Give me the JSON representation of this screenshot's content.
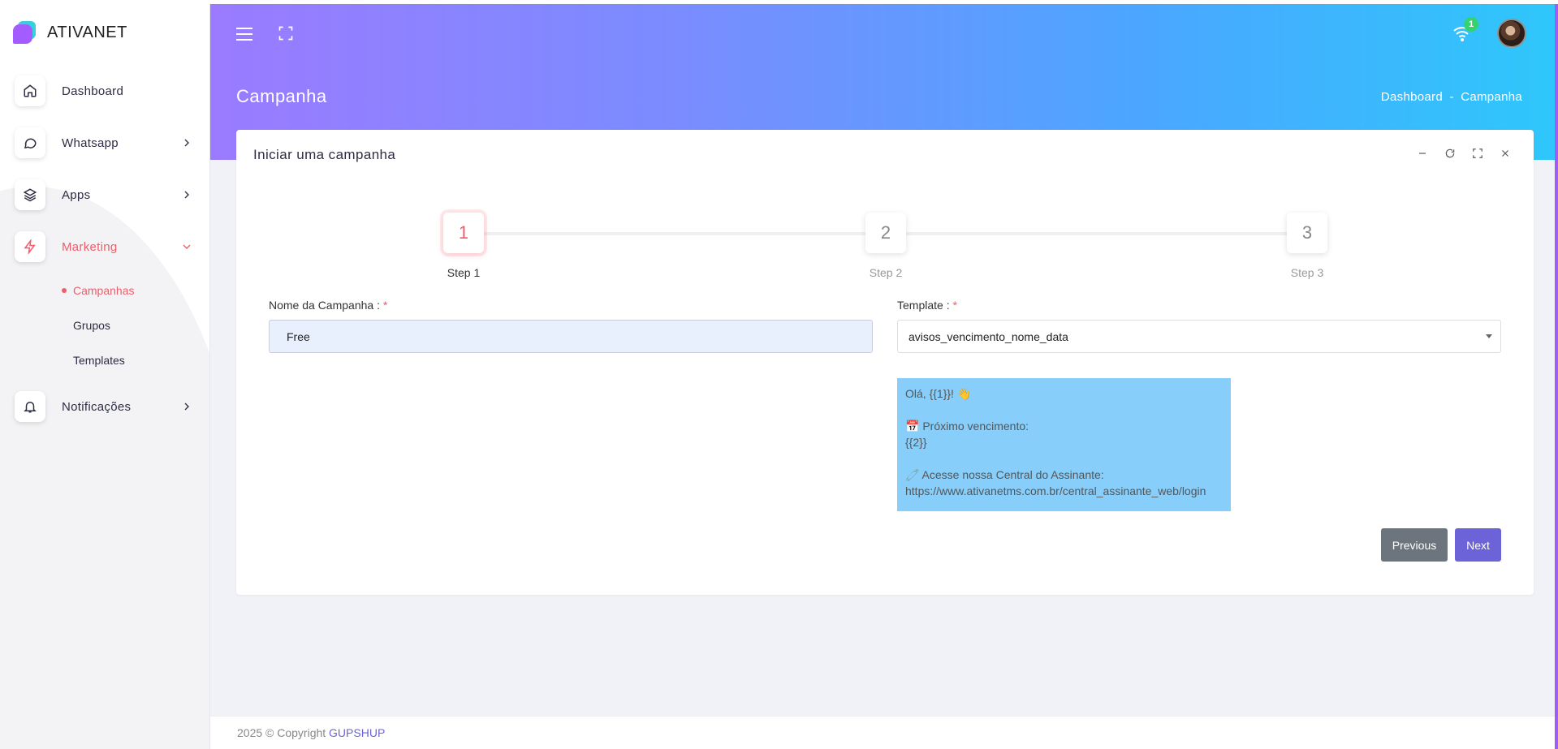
{
  "brand": {
    "name": "ATIVANET"
  },
  "sidebar": {
    "items": [
      {
        "label": "Dashboard",
        "icon": "home-icon"
      },
      {
        "label": "Whatsapp",
        "icon": "chat-icon"
      },
      {
        "label": "Apps",
        "icon": "layers-icon"
      },
      {
        "label": "Marketing",
        "icon": "bolt-icon"
      },
      {
        "label": "Notificações",
        "icon": "bell-icon"
      }
    ],
    "marketing_sub": [
      {
        "label": "Campanhas"
      },
      {
        "label": "Grupos"
      },
      {
        "label": "Templates"
      }
    ]
  },
  "header": {
    "notification_count": "1",
    "page_title": "Campanha",
    "breadcrumb": {
      "home": "Dashboard",
      "separator": "-",
      "current": "Campanha"
    }
  },
  "card": {
    "title": "Iniciar uma campanha",
    "steps": [
      {
        "number": "1",
        "label": "Step 1"
      },
      {
        "number": "2",
        "label": "Step 2"
      },
      {
        "number": "3",
        "label": "Step 3"
      }
    ],
    "campaign_name": {
      "label": "Nome da Campanha :",
      "required": "*",
      "value": "Free"
    },
    "template": {
      "label": "Template :",
      "required": "*",
      "value": "avisos_vencimento_nome_data"
    },
    "preview_text": "Olá, {{1}}! 👋\n\n📅 Próximo vencimento:\n{{2}}\n\n🧷 Acesse nossa Central do Assinante:\nhttps://www.ativanetms.com.br/central_assinante_web/login",
    "buttons": {
      "previous": "Previous",
      "next": "Next"
    }
  },
  "footer": {
    "text": "2025 © Copyright",
    "link": "GUPSHUP"
  },
  "colors": {
    "accent": "#ef5d6a",
    "primary": "#6c63d9",
    "preview_bg": "#87cefa"
  }
}
